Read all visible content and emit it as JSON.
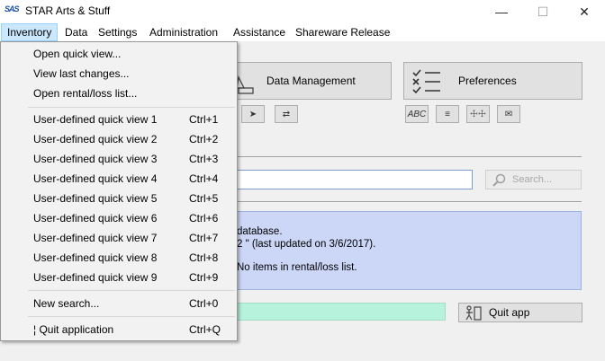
{
  "window": {
    "icon": "SAS",
    "title": "STAR Arts & Stuff",
    "minimize": "—",
    "maximize": "☐",
    "close": "✕"
  },
  "menubar": [
    "Inventory",
    "Data",
    "Settings",
    "Administration",
    "Assistance",
    "Shareware Release"
  ],
  "toolbar": {
    "data_management": "Data Management",
    "preferences": "Preferences",
    "pref_icons": [
      "ABC",
      "≡",
      "☩☩",
      "✉"
    ]
  },
  "search": {
    "value": "",
    "button": "Search..."
  },
  "info": {
    "line1": "database.",
    "line2": "2 \" (last updated on 3/6/2017).",
    "line3": "No items in rental/loss list."
  },
  "quit_button": "Quit app",
  "inventory_menu": {
    "items": [
      {
        "label": "Open quick view...",
        "shortcut": ""
      },
      {
        "label": "View last changes...",
        "shortcut": ""
      },
      {
        "label": "Open rental/loss list...",
        "shortcut": ""
      },
      {
        "label": "User-defined quick view 1",
        "shortcut": "Ctrl+1"
      },
      {
        "label": "User-defined quick view 2",
        "shortcut": "Ctrl+2"
      },
      {
        "label": "User-defined quick view 3",
        "shortcut": "Ctrl+3"
      },
      {
        "label": "User-defined quick view 4",
        "shortcut": "Ctrl+4"
      },
      {
        "label": "User-defined quick view 5",
        "shortcut": "Ctrl+5"
      },
      {
        "label": "User-defined quick view 6",
        "shortcut": "Ctrl+6"
      },
      {
        "label": "User-defined quick view 7",
        "shortcut": "Ctrl+7"
      },
      {
        "label": "User-defined quick view 8",
        "shortcut": "Ctrl+8"
      },
      {
        "label": "User-defined quick view 9",
        "shortcut": "Ctrl+9"
      },
      {
        "label": "New search...",
        "shortcut": "Ctrl+0"
      },
      {
        "label": "¦ Quit application",
        "shortcut": "Ctrl+Q"
      }
    ]
  }
}
